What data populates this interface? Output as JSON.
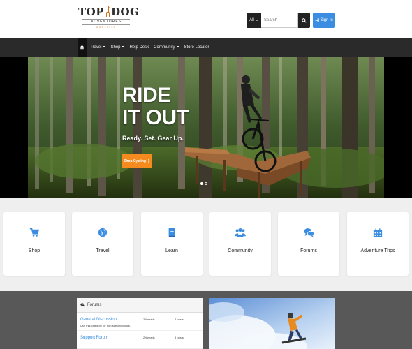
{
  "brand": {
    "name_left": "TOP",
    "name_right": "DOG",
    "tagline": "ADVENTURES",
    "established": "EST. 1999"
  },
  "search": {
    "scope": "All",
    "placeholder": "Search"
  },
  "header": {
    "signin_label": "Sign in"
  },
  "nav": {
    "items": [
      {
        "label": "Travel",
        "dropdown": true
      },
      {
        "label": "Shop",
        "dropdown": true
      },
      {
        "label": "Help Desk",
        "dropdown": false
      },
      {
        "label": "Community",
        "dropdown": true
      },
      {
        "label": "Store Locator",
        "dropdown": false
      }
    ]
  },
  "hero": {
    "title_line1": "RIDE",
    "title_line2": "IT OUT",
    "subtitle": "Ready. Set. Gear Up.",
    "cta_label": "Shop Cycling",
    "cta_color": "#f58b1f",
    "slide_count": 2,
    "active_slide": 1
  },
  "cards": [
    {
      "label": "Shop",
      "icon": "cart-icon"
    },
    {
      "label": "Travel",
      "icon": "globe-icon"
    },
    {
      "label": "Learn",
      "icon": "book-icon"
    },
    {
      "label": "Community",
      "icon": "users-icon"
    },
    {
      "label": "Forums",
      "icon": "comments-icon"
    },
    {
      "label": "Adventure Trips",
      "icon": "calendar-icon"
    }
  ],
  "forums": {
    "title": "Forums",
    "rows": [
      {
        "name": "General Discussion",
        "description": "Use this category for non-specific topics.",
        "threads": "2 threads",
        "posts": "4 posts"
      },
      {
        "name": "Support Forum",
        "description": "",
        "threads": "2 threads",
        "posts": "4 posts"
      }
    ]
  },
  "colors": {
    "accent_blue": "#3a8de0",
    "nav_bg": "#2a2a2a",
    "orange": "#f58b1f"
  }
}
